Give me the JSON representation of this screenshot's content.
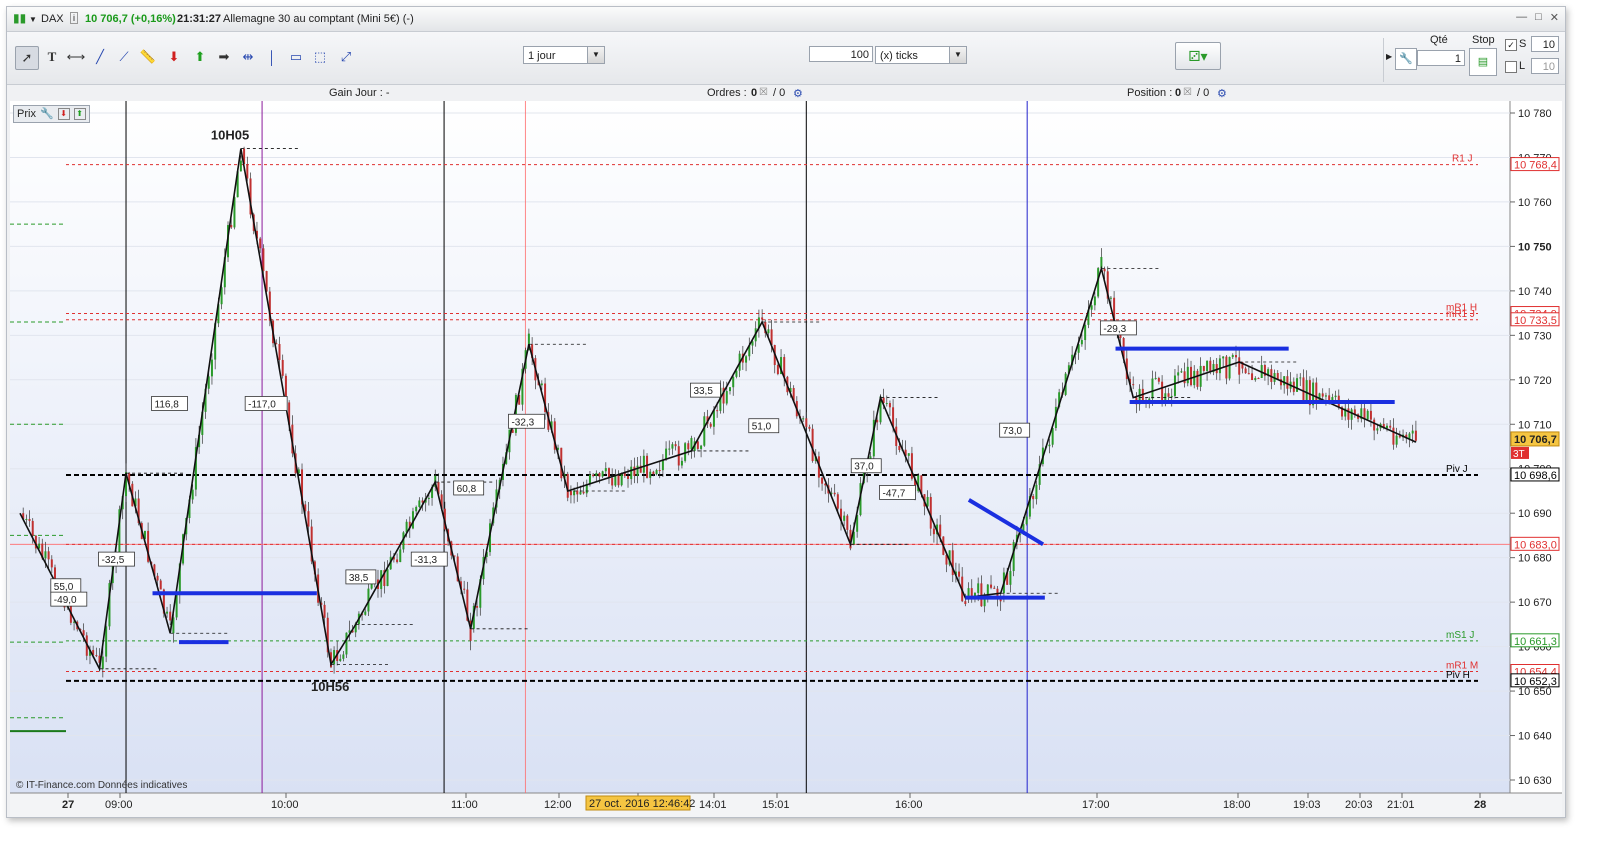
{
  "title": {
    "symbol": "DAX",
    "price_change": "10 706,7 (+0,16%)",
    "time": "21:31:27",
    "description": "Allemagne 30 au comptant (Mini 5€) (-)"
  },
  "toolbar": {
    "period": "1 jour",
    "ticks_value": "100",
    "ticks_unit": "(x) ticks",
    "qty_label": "Qté",
    "qty_value": "1",
    "stop_label": "Stop",
    "s_label": "S",
    "s_value": "10",
    "l_label": "L",
    "l_value": "10"
  },
  "info": {
    "gain": "Gain Jour : -",
    "orders_label": "Ordres :",
    "orders_a": "0",
    "orders_b": "/ 0",
    "position_label": "Position :",
    "position_a": "0",
    "position_b": "/ 0"
  },
  "prix_label": "Prix",
  "copyright": "© IT-Finance.com  Données indicatives",
  "annotations": {
    "top": "10H05",
    "bottom": "10H56"
  },
  "price_axis": {
    "ticks": [
      "10 780",
      "10 770",
      "10 760",
      "10 750",
      "10 740",
      "10 730",
      "10 720",
      "10 710",
      "10 700",
      "10 690",
      "10 680",
      "10 670",
      "10 660",
      "10 650",
      "10 640",
      "10 630"
    ],
    "bold_tick": "10 750"
  },
  "levels": [
    {
      "label": "R1 J",
      "value": "10 768,4",
      "color": "#e03030"
    },
    {
      "label": "mR1 H",
      "value": "10 734,9",
      "color": "#e03030"
    },
    {
      "label": "mR1 J",
      "value": "10 733,5",
      "color": "#e03030"
    },
    {
      "label": "Piv J",
      "value": "10 698,6",
      "color": "#000000"
    },
    {
      "label": "",
      "value": "10 683,0",
      "color": "#e03030"
    },
    {
      "label": "mS1 J",
      "value": "10 661,3",
      "color": "#2a9a2a"
    },
    {
      "label": "mR1 M",
      "value": "10 654,4",
      "color": "#e03030"
    },
    {
      "label": "Piv H",
      "value": "10 652,3",
      "color": "#000000"
    }
  ],
  "current_price": "10 706,7",
  "current_price_tag": "3T",
  "time_axis": [
    "27",
    "09:00",
    "10:00",
    "11:00",
    "12:00",
    "27 oct. 2016 12:46:42",
    "14:01",
    "15:01",
    "16:00",
    "17:00",
    "18:00",
    "19:03",
    "20:03",
    "21:01",
    "28"
  ],
  "swing_labels": [
    "116,8",
    "-117,0",
    "-32,5",
    "55,0",
    "-49,0",
    "38,5",
    "-31,3",
    "60,8",
    "-32,3",
    "33,5",
    "51,0",
    "37,0",
    "-47,7",
    "73,0",
    "-29,3"
  ],
  "chart_data": {
    "type": "line",
    "title": "",
    "xlabel": "",
    "ylabel": "",
    "ylim": [
      10625,
      10785
    ],
    "series": [
      {
        "values": [
          {
            "t": "08:00",
            "p": 10690
          },
          {
            "t": "08:45",
            "p": 10655
          },
          {
            "t": "09:00",
            "p": 10699
          },
          {
            "t": "09:25",
            "p": 10663
          },
          {
            "t": "10:05",
            "p": 10772
          },
          {
            "t": "10:56",
            "p": 10656
          },
          {
            "t": "11:10",
            "p": 10665
          },
          {
            "t": "11:55",
            "p": 10697
          },
          {
            "t": "12:15",
            "p": 10664
          },
          {
            "t": "12:48",
            "p": 10728
          },
          {
            "t": "13:10",
            "p": 10695
          },
          {
            "t": "14:20",
            "p": 10704
          },
          {
            "t": "15:00",
            "p": 10733
          },
          {
            "t": "15:50",
            "p": 10683
          },
          {
            "t": "16:07",
            "p": 10716
          },
          {
            "t": "16:55",
            "p": 10671
          },
          {
            "t": "17:15",
            "p": 10672
          },
          {
            "t": "18:12",
            "p": 10745
          },
          {
            "t": "18:30",
            "p": 10716
          },
          {
            "t": "19:30",
            "p": 10724
          },
          {
            "t": "21:10",
            "p": 10706
          }
        ]
      }
    ],
    "grid": true
  }
}
